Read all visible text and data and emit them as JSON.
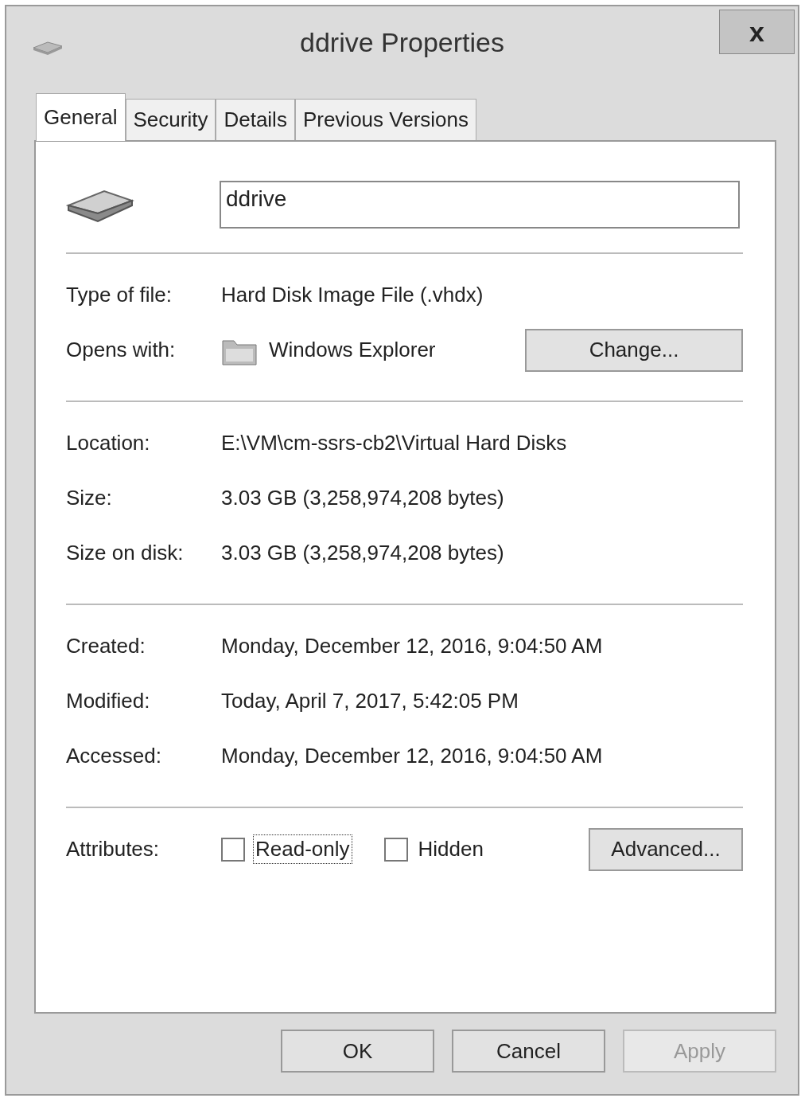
{
  "window": {
    "title": "ddrive Properties",
    "close": "x"
  },
  "tabs": [
    {
      "label": "General",
      "selected": true
    },
    {
      "label": "Security",
      "selected": false
    },
    {
      "label": "Details",
      "selected": false
    },
    {
      "label": "Previous Versions",
      "selected": false
    }
  ],
  "name_field": {
    "value": "ddrive"
  },
  "type_of_file": {
    "label": "Type of file:",
    "value": "Hard Disk Image File (.vhdx)"
  },
  "opens_with": {
    "label": "Opens with:",
    "value": "Windows Explorer",
    "button": "Change..."
  },
  "file_info": [
    {
      "label": "Location:",
      "value": "E:\\VM\\cm-ssrs-cb2\\Virtual Hard Disks"
    },
    {
      "label": "Size:",
      "value": "3.03 GB (3,258,974,208 bytes)"
    },
    {
      "label": "Size on disk:",
      "value": "3.03 GB (3,258,974,208 bytes)"
    }
  ],
  "dates": [
    {
      "label": "Created:",
      "value": "Monday, December 12, 2016, 9:04:50 AM"
    },
    {
      "label": "Modified:",
      "value": "Today, April 7, 2017, 5:42:05 PM"
    },
    {
      "label": "Accessed:",
      "value": "Monday, December 12, 2016, 9:04:50 AM"
    }
  ],
  "attributes": {
    "label": "Attributes:",
    "options": [
      {
        "label": "Read-only",
        "checked": false,
        "focused": true
      },
      {
        "label": "Hidden",
        "checked": false,
        "focused": false
      }
    ],
    "button": "Advanced..."
  },
  "buttons": [
    {
      "label": "OK",
      "disabled": false
    },
    {
      "label": "Cancel",
      "disabled": false
    },
    {
      "label": "Apply",
      "disabled": true
    }
  ]
}
